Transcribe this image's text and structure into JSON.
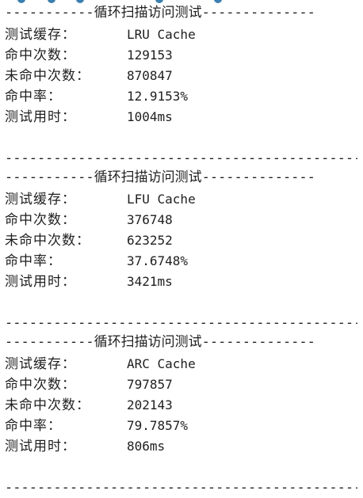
{
  "sections": [
    {
      "header": {
        "left": "-----------",
        "title": "循环扫描访问测试",
        "right": "--------------"
      },
      "rows": [
        {
          "label": "测试缓存：",
          "value": "LRU Cache"
        },
        {
          "label": "命中次数：",
          "value": "129153"
        },
        {
          "label": "未命中次数：",
          "value": "870847"
        },
        {
          "label": "命中率：",
          "value": "12.9153%"
        },
        {
          "label": "测试用时：",
          "value": "1004ms"
        }
      ],
      "rule": "--------------------------------------------"
    },
    {
      "header": {
        "left": "-----------",
        "title": "循环扫描访问测试",
        "right": "--------------"
      },
      "rows": [
        {
          "label": "测试缓存：",
          "value": "LFU Cache"
        },
        {
          "label": "命中次数：",
          "value": "376748"
        },
        {
          "label": "未命中次数：",
          "value": "623252"
        },
        {
          "label": "命中率：",
          "value": "37.6748%"
        },
        {
          "label": "测试用时：",
          "value": "3421ms"
        }
      ],
      "rule": "--------------------------------------------"
    },
    {
      "header": {
        "left": "-----------",
        "title": "循环扫描访问测试",
        "right": "--------------"
      },
      "rows": [
        {
          "label": "测试缓存：",
          "value": "ARC Cache"
        },
        {
          "label": "命中次数：",
          "value": "797857"
        },
        {
          "label": "未命中次数：",
          "value": "202143"
        },
        {
          "label": "命中率：",
          "value": "79.7857%"
        },
        {
          "label": "测试用时：",
          "value": "806ms"
        }
      ],
      "rule": "--------------------------------------------"
    }
  ]
}
